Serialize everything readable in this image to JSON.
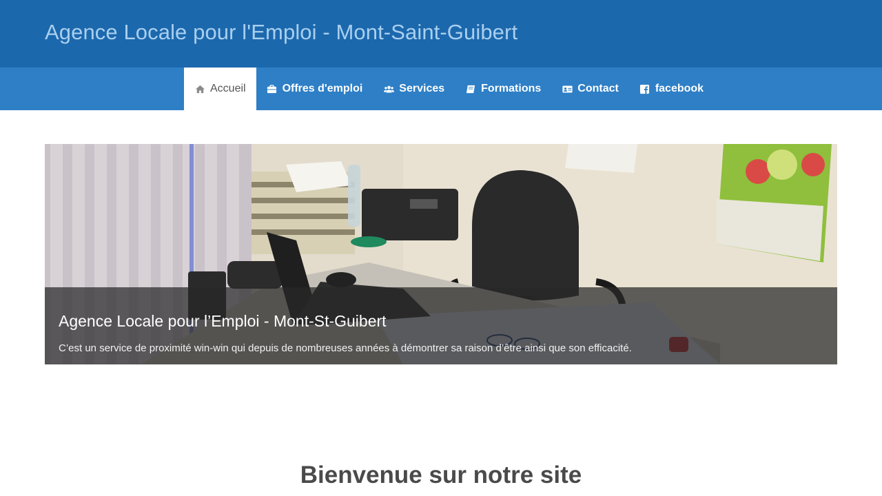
{
  "header": {
    "site_title": "Agence Locale pour l'Emploi - Mont-Saint-Guibert",
    "bg_color": "#1c68ad",
    "title_color": "#a9cfef"
  },
  "nav": {
    "bg_color": "#2e7fc6",
    "items": [
      {
        "label": "Accueil",
        "icon": "home-icon",
        "active": true
      },
      {
        "label": "Offres d'emploi",
        "icon": "briefcase-icon",
        "active": false
      },
      {
        "label": "Services",
        "icon": "users-icon",
        "active": false
      },
      {
        "label": "Formations",
        "icon": "book-icon",
        "active": false
      },
      {
        "label": "Contact",
        "icon": "id-card-icon",
        "active": false
      },
      {
        "label": "facebook",
        "icon": "facebook-icon",
        "active": false
      }
    ]
  },
  "hero": {
    "image": "office-desk-photo",
    "caption_title": "Agence Locale pour l’Emploi - Mont-St-Guibert",
    "caption_text": "C’est un service de proximité win-win qui depuis de nombreuses années à démontrer sa raison d’être ainsi que son efficacité."
  },
  "main": {
    "welcome_heading": "Bienvenue sur notre site"
  }
}
